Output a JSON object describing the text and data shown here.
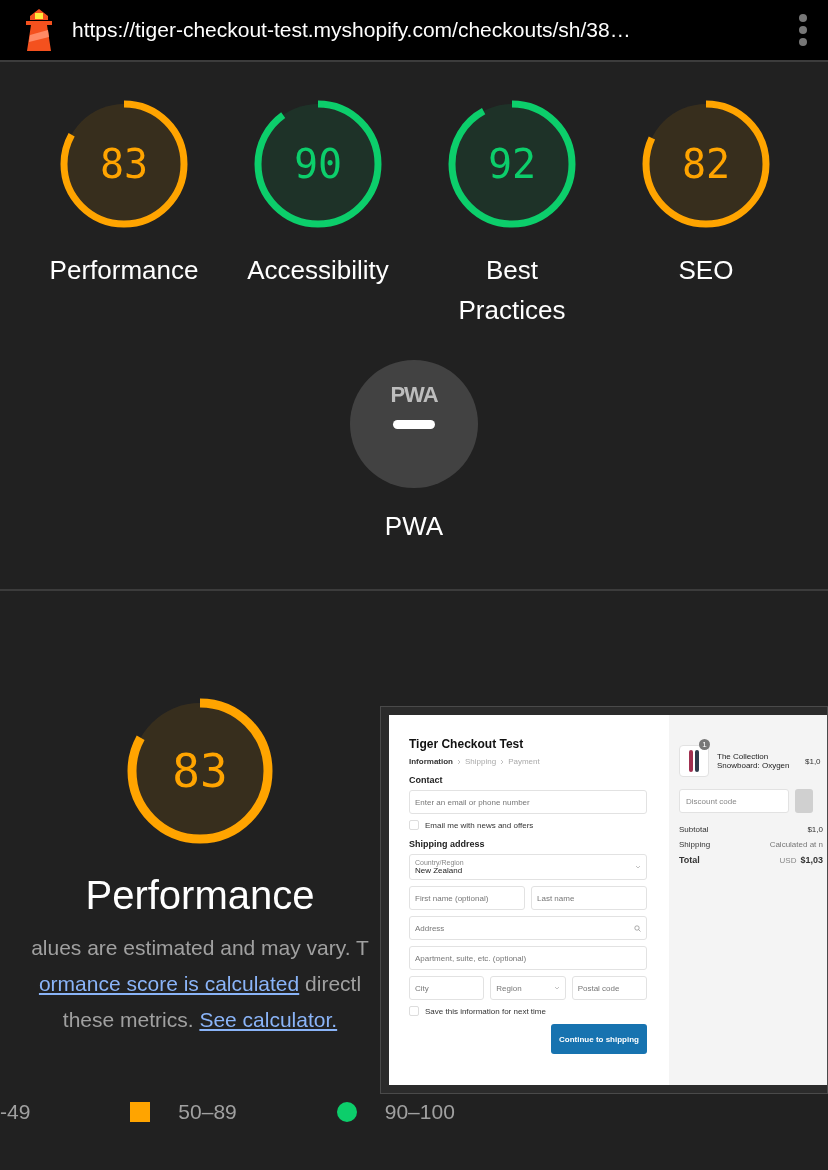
{
  "top_bar": {
    "url": "https://tiger-checkout-test.myshopify.com/checkouts/sh/38…"
  },
  "gauges": [
    {
      "score": "83",
      "label": "Performance",
      "level": 0.83,
      "color": "#ffa400"
    },
    {
      "score": "90",
      "label": "Accessibility",
      "level": 0.9,
      "color": "#0cce6b"
    },
    {
      "score": "92",
      "label": "Best Practices",
      "level": 0.92,
      "color": "#0cce6b"
    },
    {
      "score": "82",
      "label": "SEO",
      "level": 0.82,
      "color": "#ffa400"
    }
  ],
  "pwa": {
    "badge": "PWA",
    "label": "PWA"
  },
  "performance": {
    "score": "83",
    "level": 0.83,
    "color": "#ffa400",
    "title": "Performance",
    "lines": [
      {
        "parts": [
          {
            "text": "alues are estimated and may vary. T",
            "link": false
          }
        ]
      },
      {
        "parts": [
          {
            "text": "ormance score is calculated",
            "link": true
          },
          {
            "text": " directl",
            "link": false
          }
        ]
      },
      {
        "parts": [
          {
            "text": "these metrics. ",
            "link": false
          },
          {
            "text": "See calculator.",
            "link": true
          }
        ]
      }
    ],
    "legend": [
      {
        "kind": "cut",
        "label": "-49"
      },
      {
        "kind": "square",
        "label": "50–89"
      },
      {
        "kind": "circle",
        "label": "90–100"
      }
    ]
  },
  "checkout": {
    "store": "Tiger Checkout Test",
    "steps": [
      {
        "label": "Information",
        "selected": true
      },
      {
        "label": "Shipping",
        "selected": false
      },
      {
        "label": "Payment",
        "selected": false
      }
    ],
    "contact_heading": "Contact",
    "email_placeholder": "Enter an email or phone number",
    "news_checkbox": {
      "label": "Email me with news and offers",
      "checked": false
    },
    "shipping_heading": "Shipping address",
    "country": {
      "label": "Country/Region",
      "value": "New Zealand"
    },
    "rows": [
      [
        {
          "placeholder": "First name (optional)"
        },
        {
          "placeholder": "Last name"
        }
      ],
      [
        {
          "placeholder": "Address",
          "kind": "search"
        }
      ],
      [
        {
          "placeholder": "Apartment, suite, etc. (optional)"
        }
      ],
      [
        {
          "placeholder": "City"
        },
        {
          "placeholder": "Region",
          "kind": "select"
        },
        {
          "placeholder": "Postal code"
        }
      ]
    ],
    "save_checkbox": {
      "label": "Save this information for next time",
      "checked": false
    },
    "continue_button": "Continue to shipping",
    "product": {
      "quantity": "1",
      "name": "The Collection Snowboard: Oxygen",
      "price": "$1,0"
    },
    "discount_placeholder": "Discount code",
    "summary": [
      {
        "label": "Subtotal",
        "value": "$1,0",
        "kind": "plain"
      },
      {
        "label": "Shipping",
        "value": "Calculated at n",
        "kind": "note"
      },
      {
        "label": "Total",
        "currency": "USD",
        "value": "$1,03",
        "kind": "total"
      }
    ]
  }
}
